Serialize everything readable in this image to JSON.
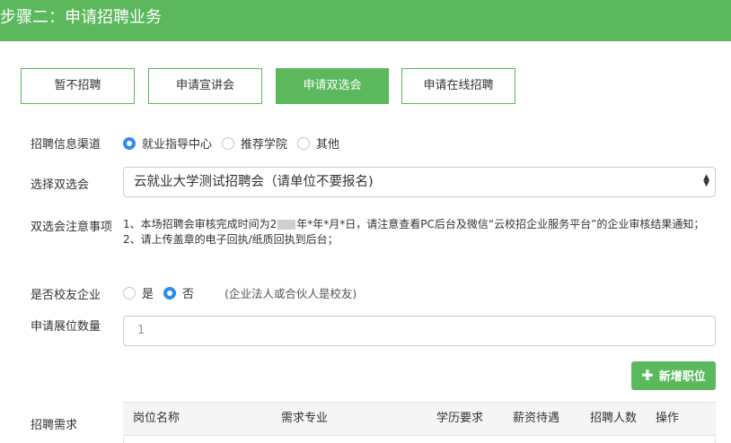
{
  "header": {
    "title": "步骤二：申请招聘业务"
  },
  "tabs": [
    {
      "label": "暂不招聘",
      "active": false
    },
    {
      "label": "申请宣讲会",
      "active": false
    },
    {
      "label": "申请双选会",
      "active": true
    },
    {
      "label": "申请在线招聘",
      "active": false
    }
  ],
  "channel": {
    "label": "招聘信息渠道",
    "options": [
      {
        "label": "就业指导中心",
        "checked": true
      },
      {
        "label": "推荐学院",
        "checked": false
      },
      {
        "label": "其他",
        "checked": false
      }
    ]
  },
  "fair": {
    "label": "选择双选会",
    "selected": "云就业大学测试招聘会（请单位不要报名)"
  },
  "notice": {
    "label": "双选会注意事项",
    "line1_pre": "1、本场招聘会审核完成时间为2",
    "line1_post": "年*年*月*日，请注意查看PC后台及微信“云校招企业服务平台”的企业审核结果通知；",
    "line2": "2、请上传盖章的电子回执/纸质回执到后台；"
  },
  "alumni": {
    "label": "是否校友企业",
    "options": [
      {
        "label": "是",
        "checked": false
      },
      {
        "label": "否",
        "checked": true
      }
    ],
    "hint": "(企业法人或合伙人是校友)"
  },
  "booth": {
    "label": "申请展位数量",
    "placeholder": "1"
  },
  "add_button": {
    "icon": "plus-icon",
    "label": "新增职位"
  },
  "demand": {
    "label": "招聘需求",
    "columns": [
      "岗位名称",
      "需求专业",
      "学历要求",
      "薪资待遇",
      "招聘人数",
      "操作"
    ]
  },
  "colors": {
    "brand": "#5cb85c",
    "radio": "#2d8cf0"
  }
}
